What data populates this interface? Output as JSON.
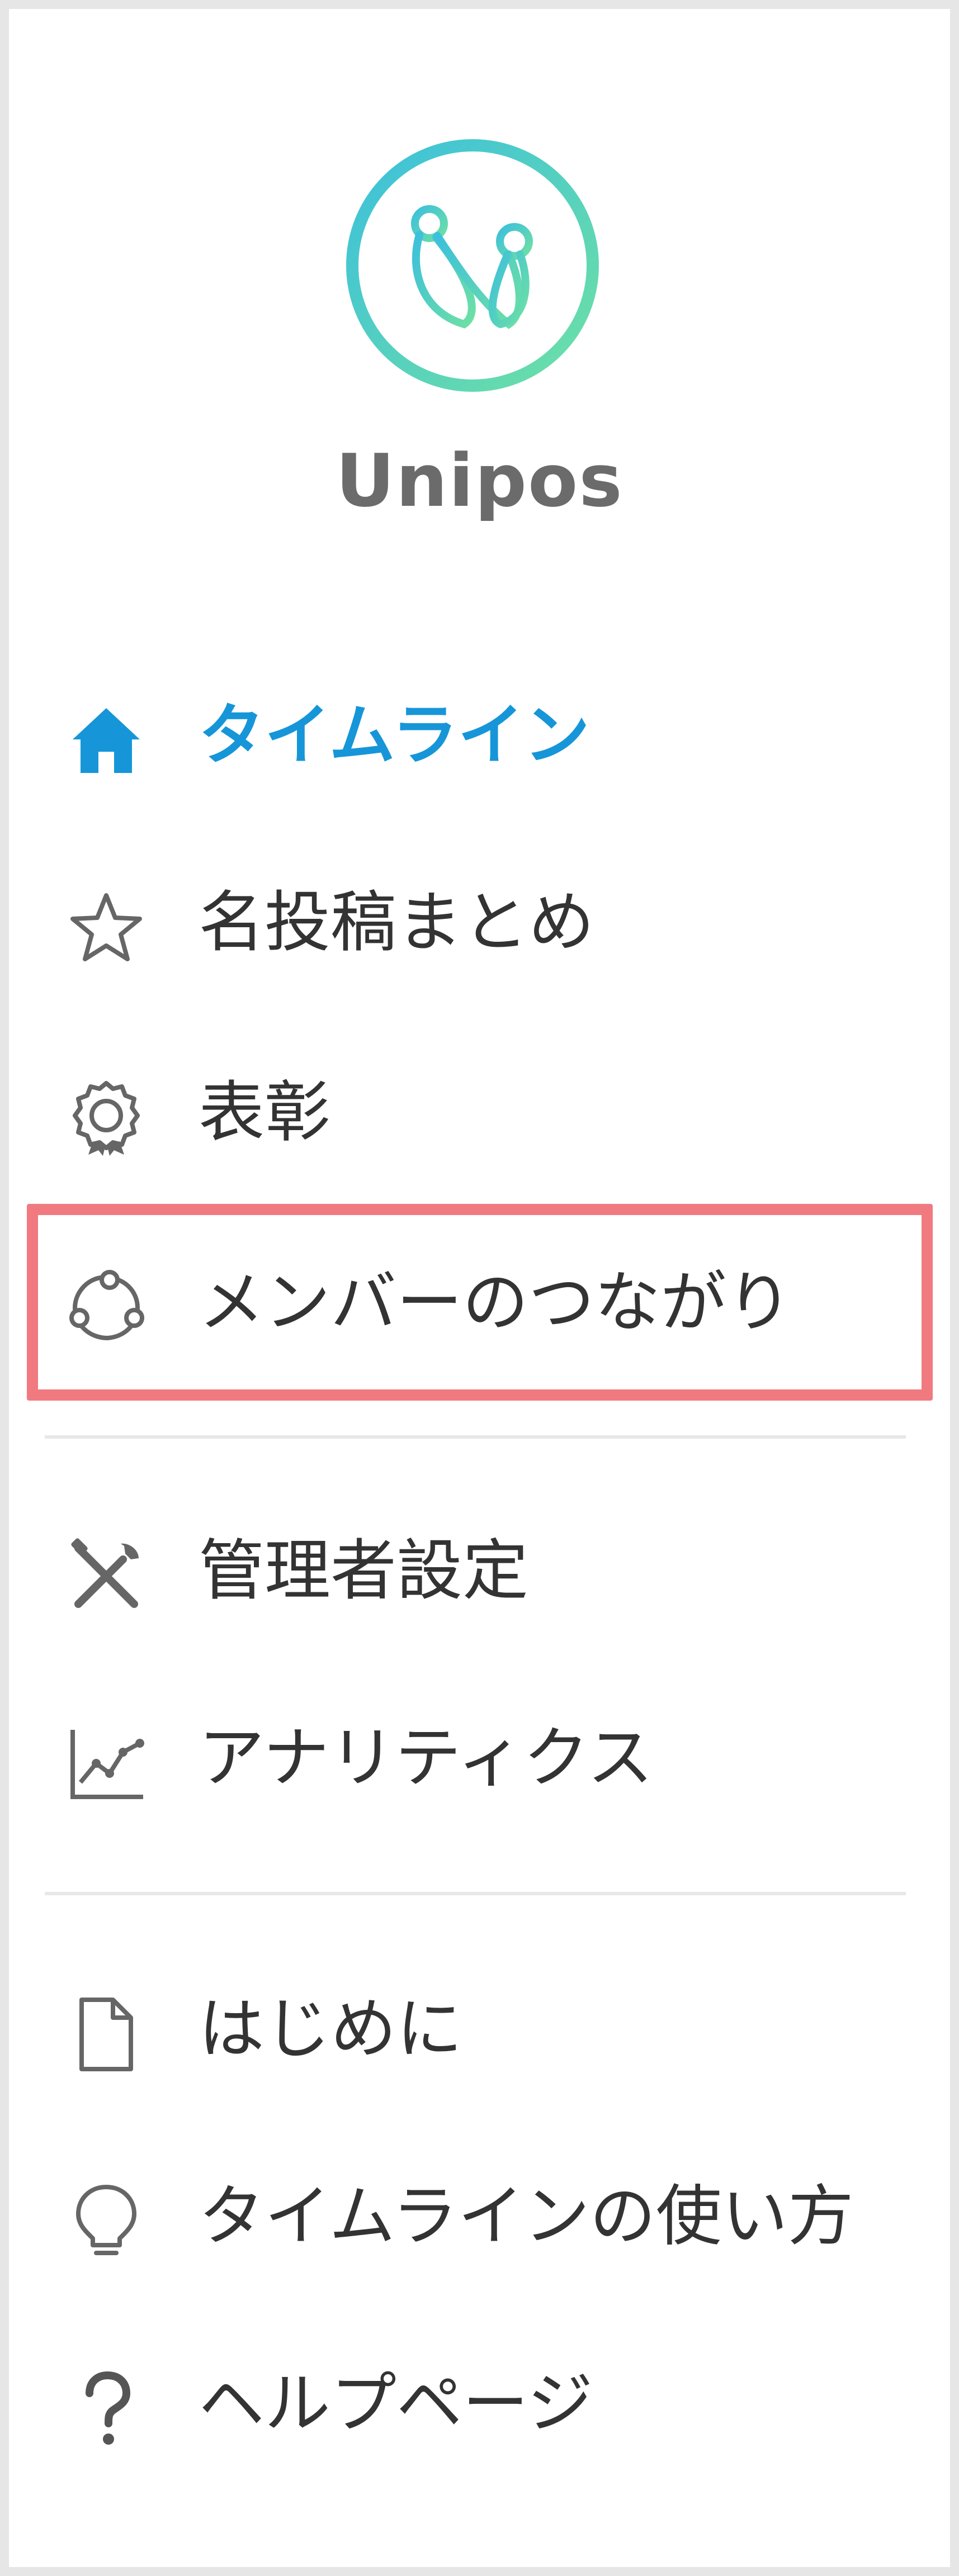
{
  "app": {
    "brand_name": "Unipos",
    "logo_colors": [
      "#3ec3d8",
      "#6ee0a8"
    ]
  },
  "nav": {
    "primary": [
      {
        "label": "タイムライン",
        "icon": "home-icon",
        "active": true
      },
      {
        "label": "名投稿まとめ",
        "icon": "star-icon",
        "active": false
      },
      {
        "label": "表彰",
        "icon": "award-badge-icon",
        "active": false
      },
      {
        "label": "メンバーのつながり",
        "icon": "network-icon",
        "active": false,
        "highlighted": true
      }
    ],
    "admin": [
      {
        "label": "管理者設定",
        "icon": "tools-icon"
      },
      {
        "label": "アナリティクス",
        "icon": "analytics-chart-icon"
      }
    ],
    "help": [
      {
        "label": "はじめに",
        "icon": "document-icon"
      },
      {
        "label": "タイムラインの使い方",
        "icon": "lightbulb-icon"
      },
      {
        "label": "ヘルプページ",
        "icon": "question-icon"
      }
    ]
  },
  "colors": {
    "active": "#1696d8",
    "text": "#333333",
    "icon": "#666666",
    "highlight_border": "#f07a80"
  }
}
